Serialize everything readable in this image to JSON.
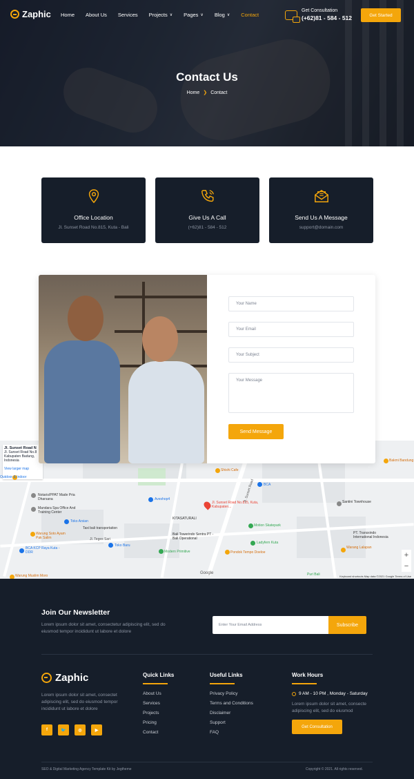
{
  "header": {
    "logo_text": "Zaphic",
    "nav": [
      {
        "label": "Home",
        "dropdown": false,
        "active": false
      },
      {
        "label": "About Us",
        "dropdown": false,
        "active": false
      },
      {
        "label": "Services",
        "dropdown": false,
        "active": false
      },
      {
        "label": "Projects",
        "dropdown": true,
        "active": false
      },
      {
        "label": "Pages",
        "dropdown": true,
        "active": false
      },
      {
        "label": "Blog",
        "dropdown": true,
        "active": false
      },
      {
        "label": "Contact",
        "dropdown": false,
        "active": true
      }
    ],
    "consult_label": "Get Consultation",
    "consult_phone": "(+62)81 - 584 - 512",
    "cta": "Get Started"
  },
  "hero": {
    "title": "Contact Us",
    "breadcrumb": [
      "Home",
      "Contact"
    ]
  },
  "info_cards": [
    {
      "icon": "map-pin-icon",
      "title": "Office Location",
      "text": "Jl. Sunset Road No.815, Kuta - Bali"
    },
    {
      "icon": "phone-icon",
      "title": "Give Us A Call",
      "text": "(+62)81 - 584 - 512"
    },
    {
      "icon": "mail-icon",
      "title": "Send Us A Message",
      "text": "support@domain.com"
    }
  ],
  "contact_form": {
    "name_placeholder": "Your Name",
    "email_placeholder": "Your Email",
    "subject_placeholder": "Your Subject",
    "message_placeholder": "Your Message",
    "submit": "Send Message"
  },
  "map": {
    "info_title": "Jl. Sunset Road N",
    "info_lines": [
      "Jl. Sunset Road No.8",
      "Kabupaten Badung,",
      "Indonesia"
    ],
    "view_larger": "View larger map",
    "pin_label": "Jl. Sunset Road No.815, Kuta, Kabupaten...",
    "places": [
      "Outdoor & Indoor",
      "Shishi Cafe",
      "BCA",
      "Notaris/PPAT Made Pria Dharsana",
      "Mandara Spa Office And Training Center",
      "Aveshop4",
      "Toko Arsian",
      "Taxi bali transportation",
      "KITASATURALI",
      "Motion Skatepark",
      "Santini Townhouse",
      "Warung Soto Ayam Pak Salim",
      "BCA KCP Raya Kuta - DDR",
      "Toko Baru",
      "Bali Towerindo Sentra PT - Bali Operational",
      "Ladyfern Kuta",
      "Modern Primitive",
      "Pondok Tempo Doeloe",
      "Warung Muslim Moro",
      "Bakmi Bandung",
      "PT. Transxindo International Indonesia",
      "Warang Lalapan",
      "Puri Bali"
    ],
    "roads": [
      "Jl. Sunset Road",
      "Jl. Teges Sari"
    ],
    "footer": "Keyboard shortcuts   Map data ©2021 Google   Terms of Use",
    "zoom_in": "+",
    "zoom_out": "−",
    "brand": "Google"
  },
  "newsletter": {
    "title": "Join Our Newsletter",
    "text": "Lorem ipsum dolor sit amet, consectetur adipiscing elit, sed do eiusmod tempor incididunt ut labore et dolore",
    "placeholder": "Enter Your Email Address",
    "button": "Subscribe"
  },
  "footer": {
    "logo_text": "Zaphic",
    "about": "Lorem ipsum dolor sit amet, consectet adipiscing elit, sed do eiusmod tempor incididunt ut labore et dolore",
    "socials": [
      "facebook-icon",
      "twitter-icon",
      "instagram-icon",
      "youtube-icon"
    ],
    "quick_links_title": "Quick Links",
    "quick_links": [
      "About Us",
      "Services",
      "Projects",
      "Pricing",
      "Contact"
    ],
    "useful_links_title": "Useful Links",
    "useful_links": [
      "Privacy Policy",
      "Terms and Conditions",
      "Disclaimer",
      "Support",
      "FAQ"
    ],
    "work_hours_title": "Work Hours",
    "work_hours": "9 AM - 10 PM , Monday - Saturday",
    "work_text": "Lorem ipsum dolor sit amet, consecte adipiscing elit, sed do eiusmod",
    "work_button": "Get Consultation",
    "copyright_left": "SEO & Digital Marketing Agency Template Kit by Jegtheme",
    "copyright_right": "Copyright © 2021. All rights reserved."
  },
  "colors": {
    "accent": "#f4a60b",
    "dark": "#161e2a",
    "pin": "#ea4335"
  }
}
